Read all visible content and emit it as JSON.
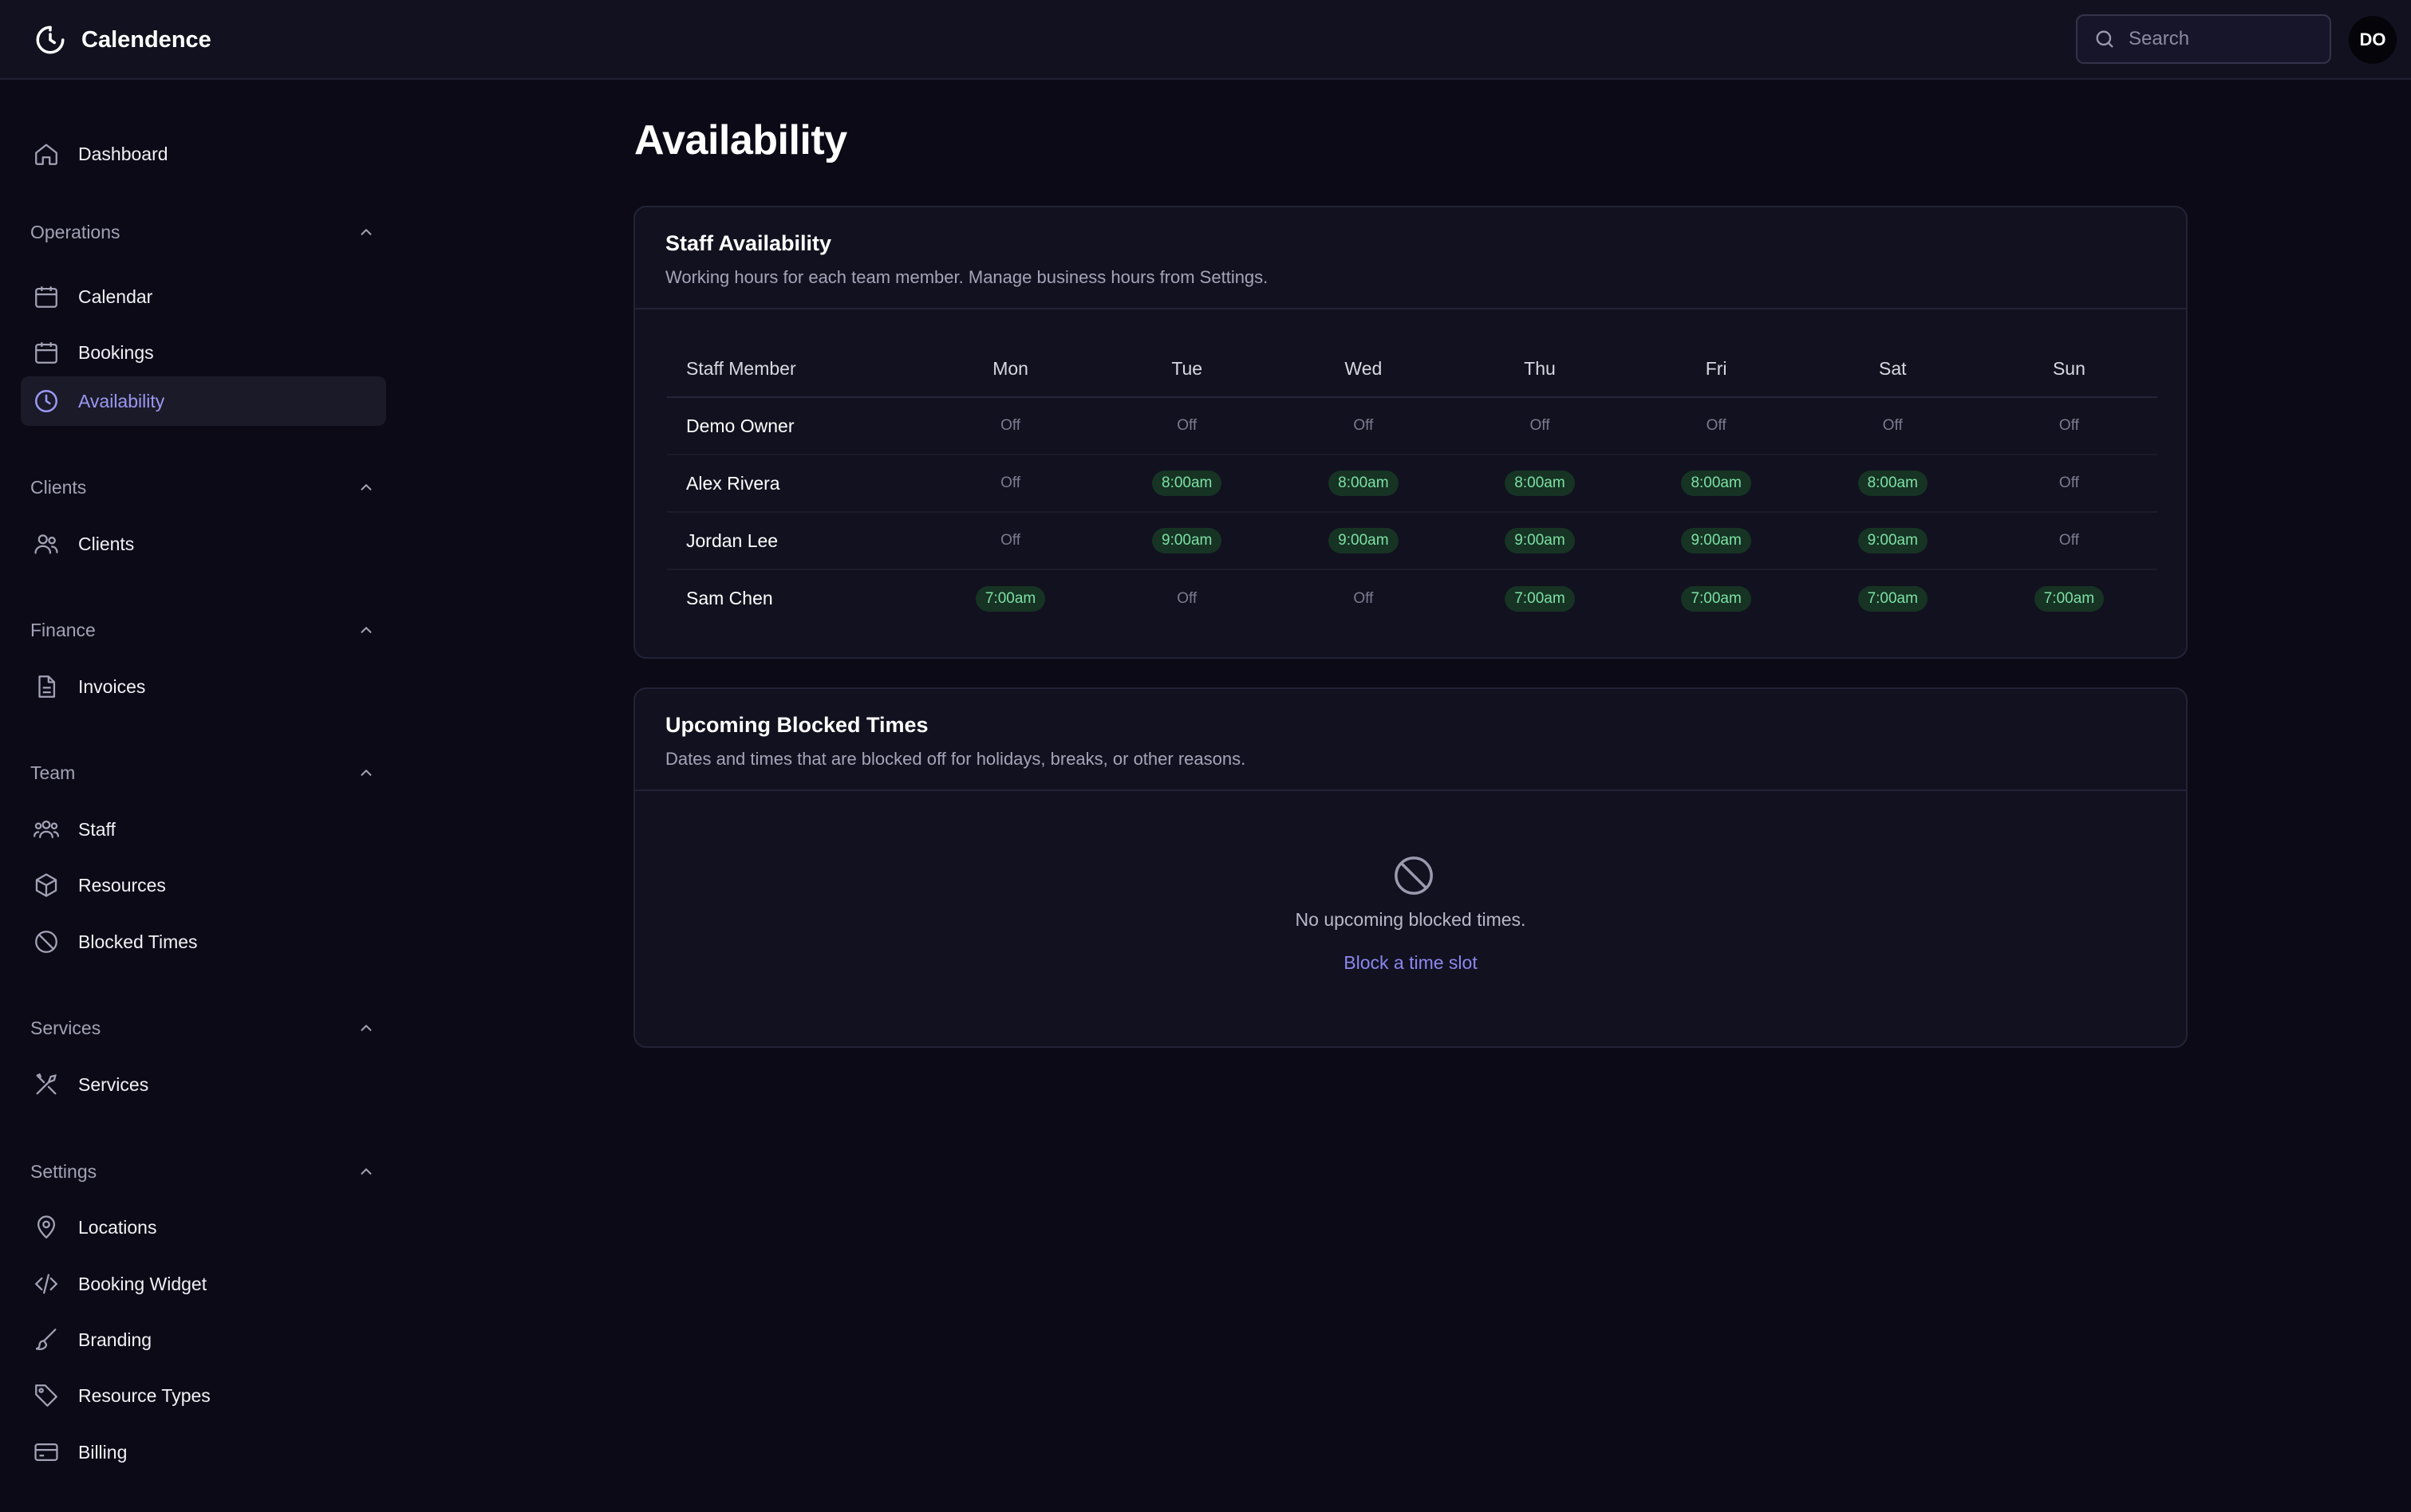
{
  "app": {
    "name": "Calendence",
    "search_placeholder": "Search",
    "user_initials": "DO"
  },
  "sidebar": {
    "dashboard": "Dashboard",
    "sections": [
      {
        "title": "Operations",
        "items": [
          {
            "label": "Calendar",
            "icon": "calendar-icon"
          },
          {
            "label": "Bookings",
            "icon": "calendar-icon"
          },
          {
            "label": "Availability",
            "icon": "clock-icon",
            "active": true
          }
        ]
      },
      {
        "title": "Clients",
        "items": [
          {
            "label": "Clients",
            "icon": "users-icon"
          }
        ]
      },
      {
        "title": "Finance",
        "items": [
          {
            "label": "Invoices",
            "icon": "document-icon"
          }
        ]
      },
      {
        "title": "Team",
        "items": [
          {
            "label": "Staff",
            "icon": "team-icon"
          },
          {
            "label": "Resources",
            "icon": "cube-icon"
          },
          {
            "label": "Blocked Times",
            "icon": "ban-icon"
          }
        ]
      },
      {
        "title": "Services",
        "items": [
          {
            "label": "Services",
            "icon": "tools-icon"
          }
        ]
      },
      {
        "title": "Settings",
        "items": [
          {
            "label": "Locations",
            "icon": "map-pin-icon"
          },
          {
            "label": "Booking Widget",
            "icon": "code-icon"
          },
          {
            "label": "Branding",
            "icon": "brush-icon"
          },
          {
            "label": "Resource Types",
            "icon": "tag-icon"
          },
          {
            "label": "Billing",
            "icon": "credit-card-icon"
          }
        ]
      }
    ]
  },
  "page": {
    "title": "Availability"
  },
  "staff_availability": {
    "title": "Staff Availability",
    "subtitle": "Working hours for each team member. Manage business hours from Settings.",
    "columns": [
      "Staff Member",
      "Mon",
      "Tue",
      "Wed",
      "Thu",
      "Fri",
      "Sat",
      "Sun"
    ],
    "rows": [
      {
        "name": "Demo Owner",
        "days": [
          "Off",
          "Off",
          "Off",
          "Off",
          "Off",
          "Off",
          "Off"
        ]
      },
      {
        "name": "Alex Rivera",
        "days": [
          "Off",
          "8:00am",
          "8:00am",
          "8:00am",
          "8:00am",
          "8:00am",
          "Off"
        ]
      },
      {
        "name": "Jordan Lee",
        "days": [
          "Off",
          "9:00am",
          "9:00am",
          "9:00am",
          "9:00am",
          "9:00am",
          "Off"
        ]
      },
      {
        "name": "Sam Chen",
        "days": [
          "7:00am",
          "Off",
          "Off",
          "7:00am",
          "7:00am",
          "7:00am",
          "7:00am"
        ]
      }
    ]
  },
  "blocked_times": {
    "title": "Upcoming Blocked Times",
    "subtitle": "Dates and times that are blocked off for holidays, breaks, or other reasons.",
    "empty_text": "No upcoming blocked times.",
    "cta": "Block a time slot"
  },
  "colors": {
    "accent": "#8a87f0",
    "working_pill_bg": "#163324",
    "working_pill_text": "#7ee0a4"
  }
}
